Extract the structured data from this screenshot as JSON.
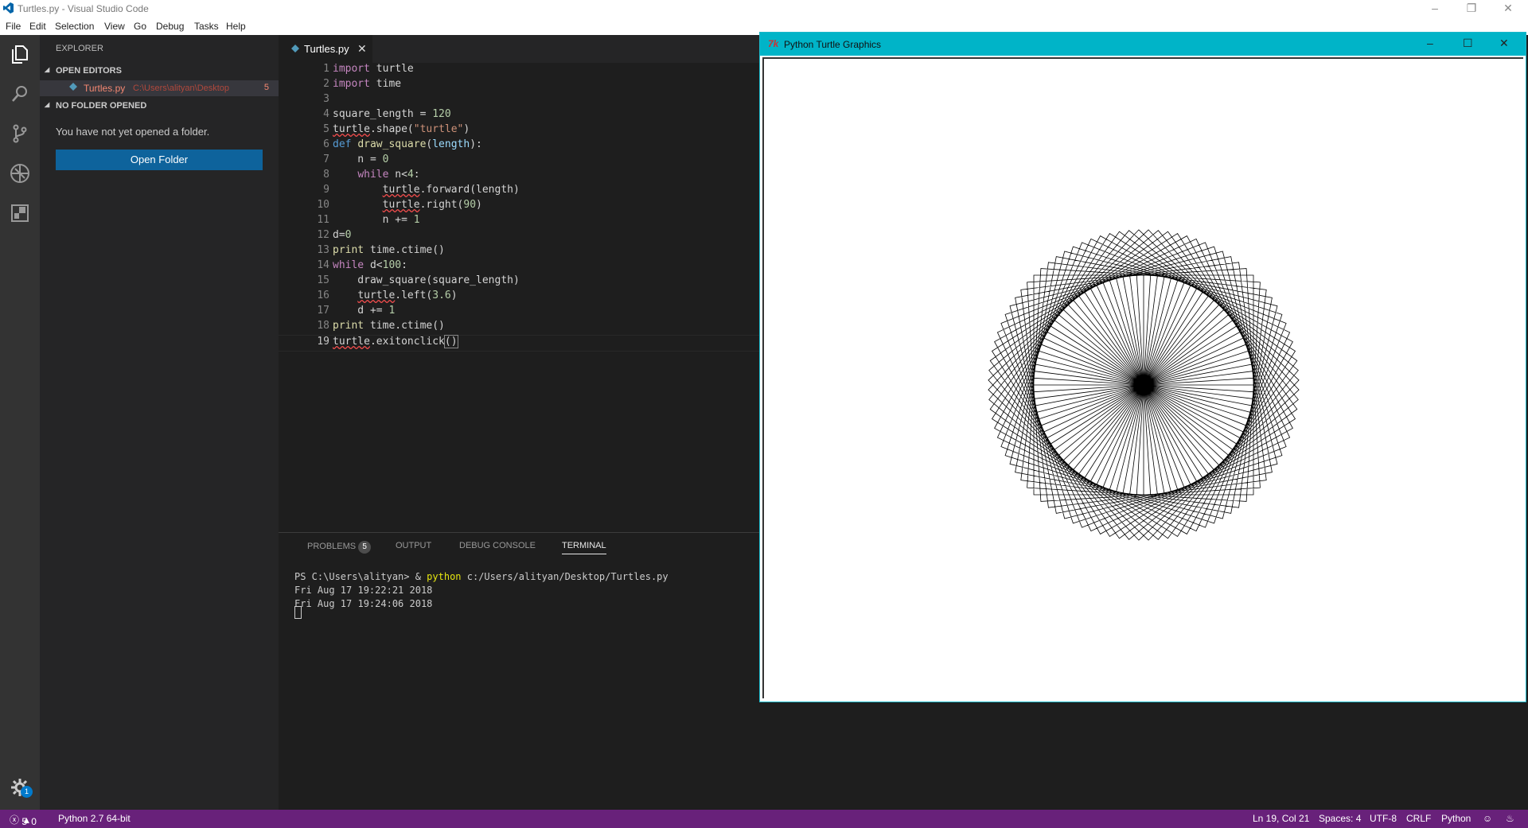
{
  "window": {
    "title": "Turtles.py - Visual Studio Code"
  },
  "menu": [
    "File",
    "Edit",
    "Selection",
    "View",
    "Go",
    "Debug",
    "Tasks",
    "Help"
  ],
  "sidebar": {
    "header": "EXPLORER",
    "open_editors": "OPEN EDITORS",
    "open_file": {
      "name": "Turtles.py",
      "path": "C:\\Users\\alityan\\Desktop",
      "problems": "5"
    },
    "no_folder": "NO FOLDER OPENED",
    "message": "You have not yet opened a folder.",
    "open_folder_button": "Open Folder"
  },
  "activity": {
    "settings_badge": "1"
  },
  "editor": {
    "tab": "Turtles.py",
    "lines": [
      "1",
      "2",
      "3",
      "4",
      "5",
      "6",
      "7",
      "8",
      "9",
      "10",
      "11",
      "12",
      "13",
      "14",
      "15",
      "16",
      "17",
      "18",
      "19"
    ]
  },
  "panel": {
    "tabs": [
      "PROBLEMS",
      "OUTPUT",
      "DEBUG CONSOLE",
      "TERMINAL"
    ],
    "problems_count": "5",
    "terminal": {
      "prompt": "PS C:\\Users\\alityan> & ",
      "command": "python",
      "args": " c:/Users/alityan/Desktop/Turtles.py",
      "out1": "Fri Aug 17 19:22:21 2018",
      "out2": "Fri Aug 17 19:24:06 2018"
    }
  },
  "status": {
    "errors": "5",
    "warnings": "0",
    "interpreter": "Python 2.7 64-bit",
    "position": "Ln 19, Col 21",
    "spaces": "Spaces: 4",
    "encoding": "UTF-8",
    "eol": "CRLF",
    "language": "Python"
  },
  "turtle_window": {
    "title": "Python Turtle Graphics",
    "square_length": 120,
    "squares": 100,
    "turn_deg": 3.6
  }
}
